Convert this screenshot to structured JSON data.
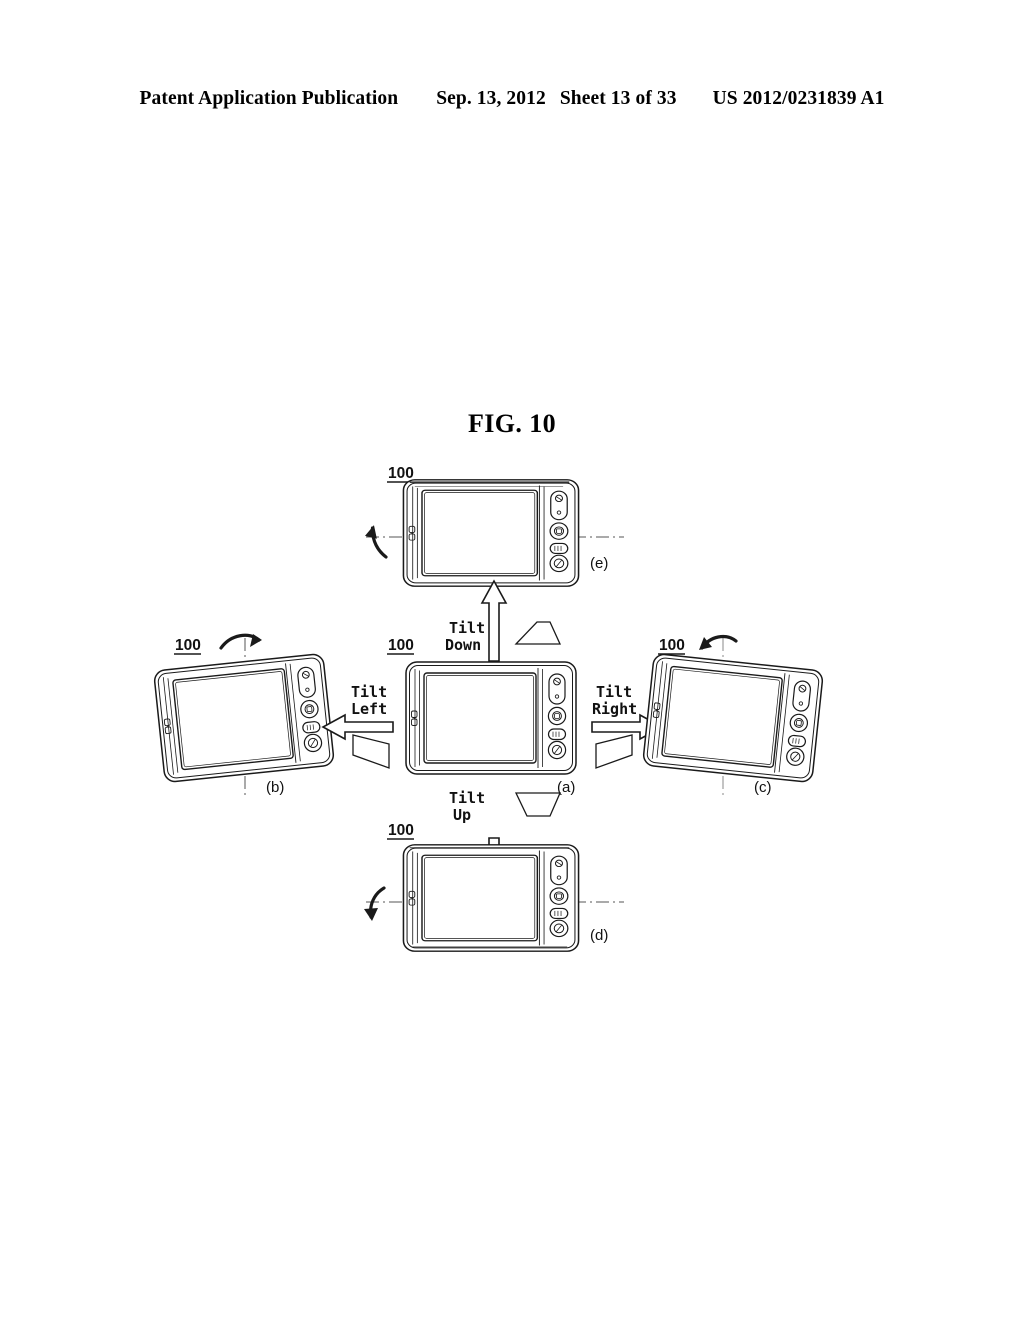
{
  "header": {
    "publication": "Patent Application Publication",
    "date": "Sep. 13, 2012",
    "sheet": "Sheet 13 of 33",
    "patent_number": "US 2012/0231839 A1"
  },
  "figure": {
    "title": "FIG. 10",
    "reference_numeral": "100",
    "line_color": "#1a1a1a",
    "panels": [
      {
        "id": "a",
        "label": "(a)",
        "reference_numeral": "100",
        "description": "reference orientation, front view"
      },
      {
        "id": "b",
        "label": "(b)",
        "reference_numeral": "100",
        "description": "tilted left about vertical axis"
      },
      {
        "id": "c",
        "label": "(c)",
        "reference_numeral": "100",
        "description": "tilted right about vertical axis"
      },
      {
        "id": "d",
        "label": "(d)",
        "reference_numeral": "100",
        "description": "tilted up about horizontal axis"
      },
      {
        "id": "e",
        "label": "(e)",
        "reference_numeral": "100",
        "description": "tilted down about horizontal axis"
      }
    ],
    "transitions": [
      {
        "id": "tilt-down",
        "line1": "Tilt",
        "line2": "Down",
        "arrow": "up"
      },
      {
        "id": "tilt-up",
        "line1": "Tilt",
        "line2": "Up",
        "arrow": "down"
      },
      {
        "id": "tilt-left",
        "line1": "Tilt",
        "line2": "Left",
        "arrow": "left"
      },
      {
        "id": "tilt-right",
        "line1": "Tilt",
        "line2": "Right",
        "arrow": "right"
      }
    ]
  }
}
